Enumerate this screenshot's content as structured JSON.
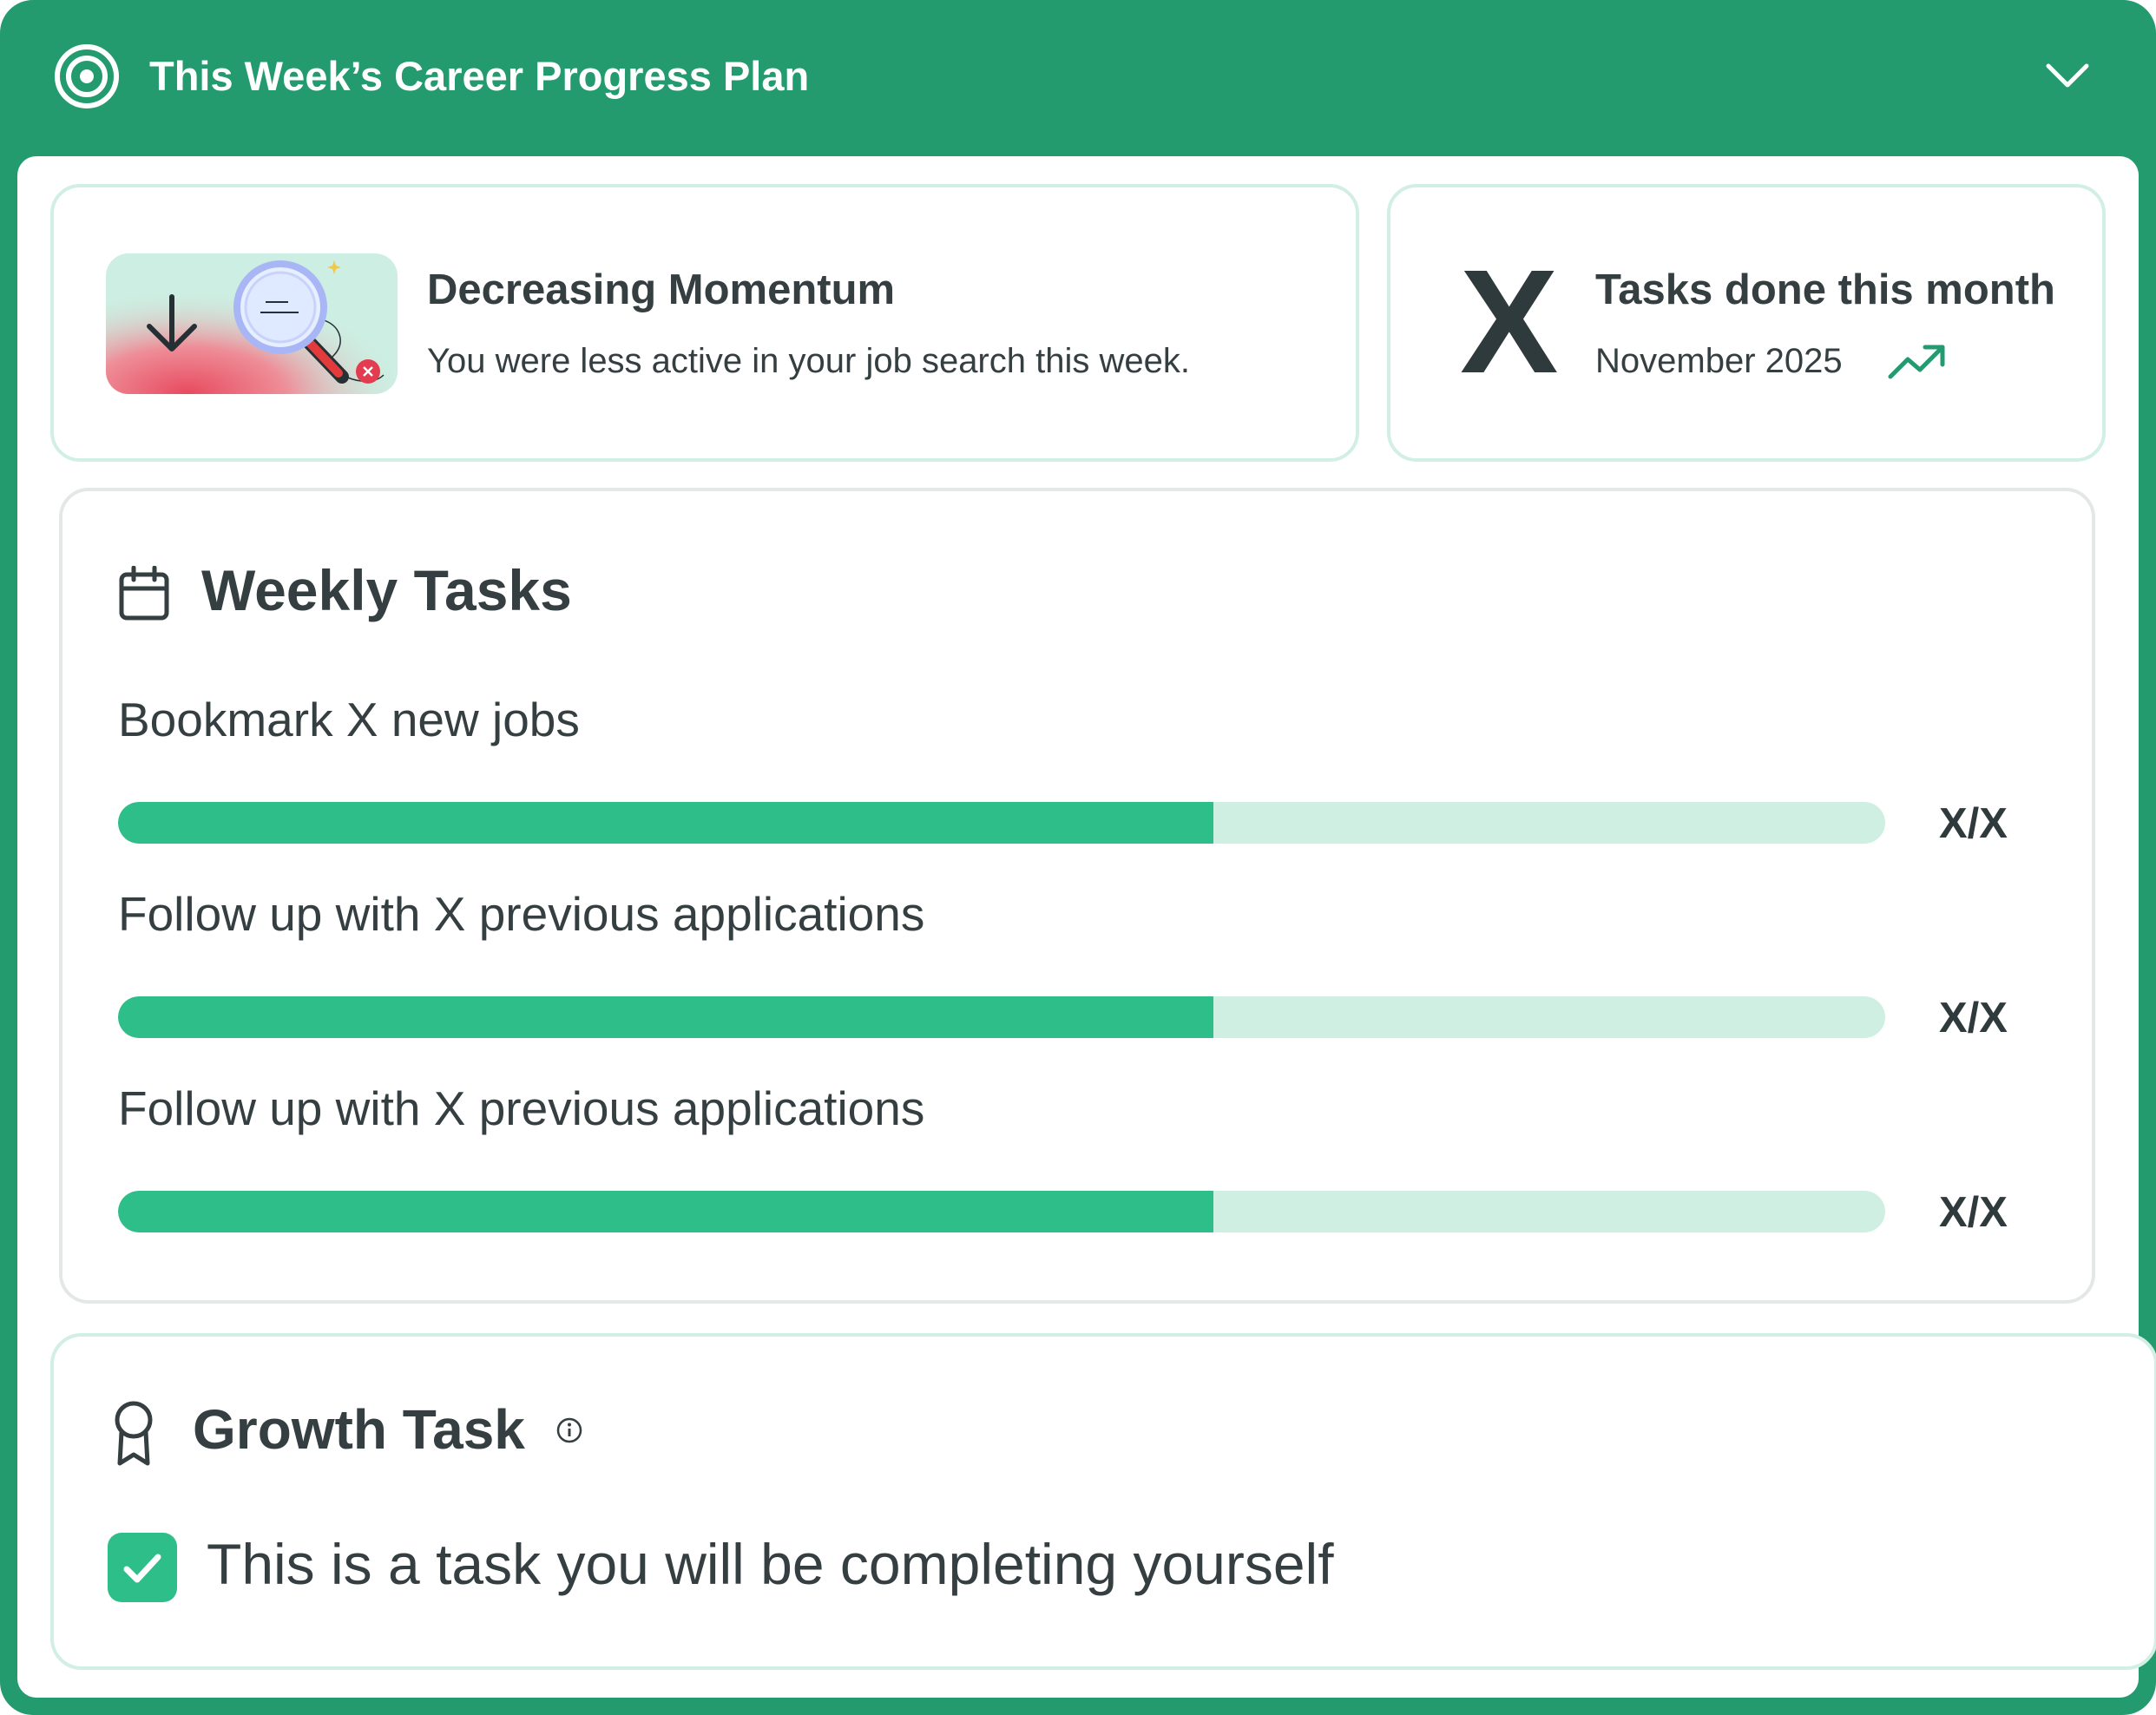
{
  "header": {
    "title": "This Week’s Career Progress Plan",
    "icon": "target-icon",
    "toggle_icon": "chevron-down-icon"
  },
  "momentum": {
    "title": "Decreasing Momentum",
    "description": "You were less active in your job search this week.",
    "illustration": "magnifying-glass-down-arrow-illustration"
  },
  "monthly": {
    "count": "X",
    "title": "Tasks done this month",
    "date": "November 2025",
    "trend_icon": "trend-up-icon"
  },
  "weekly": {
    "title": "Weekly Tasks",
    "icon": "calendar-icon",
    "tasks": [
      {
        "label": "Bookmark X new jobs",
        "count": "X/X",
        "progress": 0.62
      },
      {
        "label": "Follow up with X previous applications",
        "count": "X/X",
        "progress": 0.62
      },
      {
        "label": "Follow up with X previous applications",
        "count": "X/X",
        "progress": 0.62
      }
    ]
  },
  "growth": {
    "title": "Growth Task",
    "icon": "award-ribbon-icon",
    "info_icon": "info-icon",
    "task_text": "This is a task you will be completing yourself",
    "checked": true
  },
  "colors": {
    "brand_green": "#249a6f",
    "progress_fill": "#2ebe8a",
    "progress_track": "#cfefe2",
    "card_border": "#d2efe5",
    "text_dark": "#353f42"
  }
}
